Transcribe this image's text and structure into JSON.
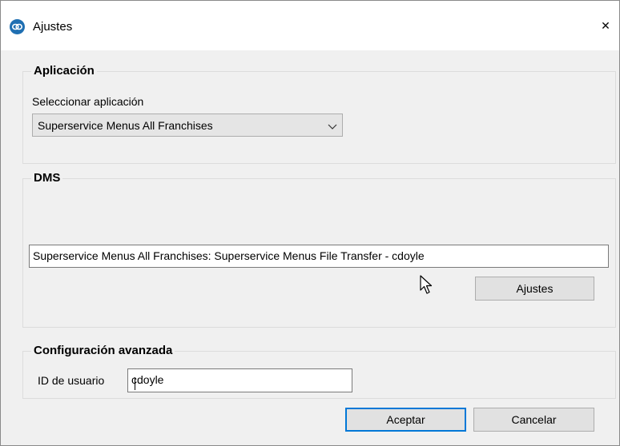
{
  "window": {
    "title": "Ajustes",
    "close_glyph": "✕",
    "app_icon": "link-icon"
  },
  "application_group": {
    "title": "Aplicación",
    "select_label": "Seleccionar aplicación",
    "selected_app": "Superservice Menus All Franchises"
  },
  "dms_group": {
    "title": "DMS",
    "connection_value": "Superservice Menus All Franchises: Superservice Menus File Transfer - cdoyle",
    "settings_button": "Ajustes"
  },
  "advanced_group": {
    "title": "Configuración avanzada",
    "user_id_label": "ID de usuario",
    "user_id_value": "cdoyle"
  },
  "footer": {
    "accept": "Aceptar",
    "cancel": "Cancelar"
  },
  "colors": {
    "accent": "#0078d7",
    "dialog_bg": "#f0f0f0"
  }
}
